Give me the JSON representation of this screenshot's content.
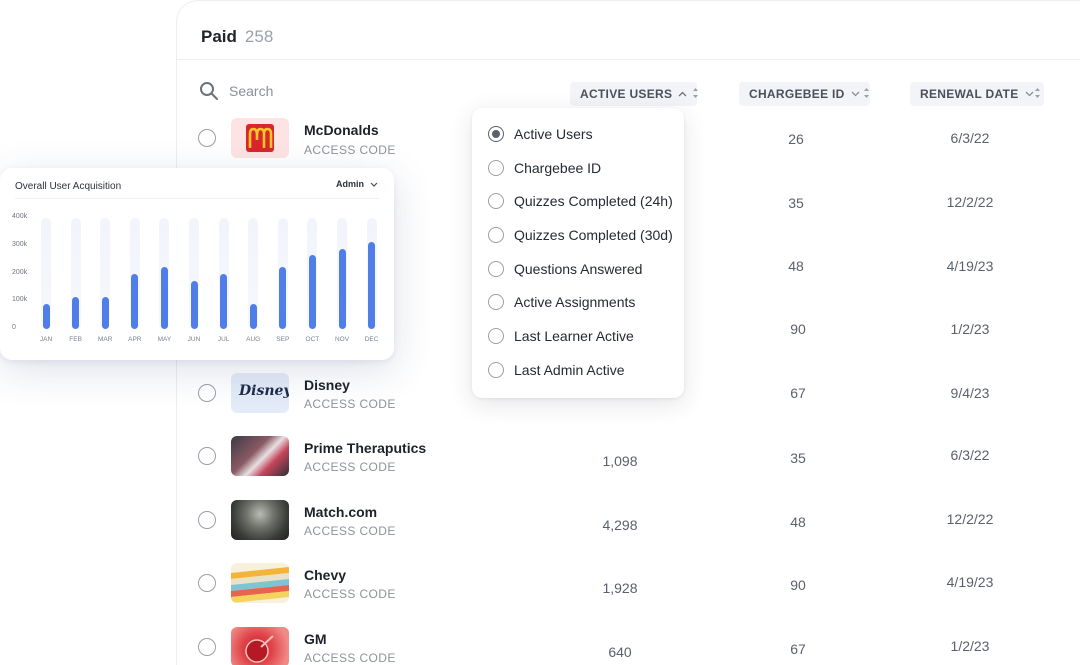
{
  "header": {
    "title": "Paid",
    "count": "258"
  },
  "search": {
    "placeholder": "Search"
  },
  "columns": {
    "active_users": "ACTIVE USERS",
    "chargebee_id": "CHARGEBEE ID",
    "renewal_date": "RENEWAL DATE"
  },
  "rows": [
    {
      "name": "McDonalds",
      "code": "ACCESS CODE",
      "active_users": "",
      "chargebee_id": "26",
      "renewal": "6/3/22"
    },
    {
      "name": "",
      "code": "",
      "active_users": "",
      "chargebee_id": "35",
      "renewal": "12/2/22"
    },
    {
      "name": "",
      "code": "",
      "active_users": "",
      "chargebee_id": "48",
      "renewal": "4/19/23"
    },
    {
      "name": "",
      "code": "",
      "active_users": "",
      "chargebee_id": "90",
      "renewal": "1/2/23"
    },
    {
      "name": "Disney",
      "code": "ACCESS CODE",
      "active_users": "",
      "chargebee_id": "67",
      "renewal": "9/4/23",
      "logo_text": "Disney"
    },
    {
      "name": "Prime Theraputics",
      "code": "ACCESS CODE",
      "active_users": "1,098",
      "chargebee_id": "35",
      "renewal": "6/3/22"
    },
    {
      "name": "Match.com",
      "code": "ACCESS CODE",
      "active_users": "4,298",
      "chargebee_id": "48",
      "renewal": "12/2/22"
    },
    {
      "name": "Chevy",
      "code": "ACCESS CODE",
      "active_users": "1,928",
      "chargebee_id": "90",
      "renewal": "4/19/23"
    },
    {
      "name": "GM",
      "code": "ACCESS CODE",
      "active_users": "640",
      "chargebee_id": "67",
      "renewal": "1/2/23"
    }
  ],
  "dropdown": {
    "selected": "Active Users",
    "options": [
      "Active Users",
      "Chargebee ID",
      "Quizzes Completed (24h)",
      "Quizzes Completed (30d)",
      "Questions Answered",
      "Active Assignments",
      "Last Learner Active",
      "Last Admin Active"
    ]
  },
  "chart_card": {
    "title": "Overall User Acquisition",
    "filter": "Admin"
  },
  "chart_data": {
    "type": "bar",
    "title": "Overall User Acquisition",
    "xlabel": "",
    "ylabel": "",
    "categories": [
      "JAN",
      "FEB",
      "MAR",
      "APR",
      "MAY",
      "JUN",
      "JUL",
      "AUG",
      "SEP",
      "OCT",
      "NOV",
      "DEC"
    ],
    "values": [
      90000,
      115000,
      115000,
      200000,
      222000,
      172000,
      200000,
      90000,
      222000,
      268000,
      290000,
      312000
    ],
    "yticks": [
      "0",
      "100k",
      "200k",
      "300k",
      "400k"
    ],
    "ylim": [
      0,
      400000
    ],
    "bar_color": "#4f7ee8",
    "grid": false
  },
  "colors": {
    "accent": "#4f7ee8",
    "mcdonalds_red": "#d8262a",
    "mcdonalds_yellow": "#ffc72c"
  }
}
